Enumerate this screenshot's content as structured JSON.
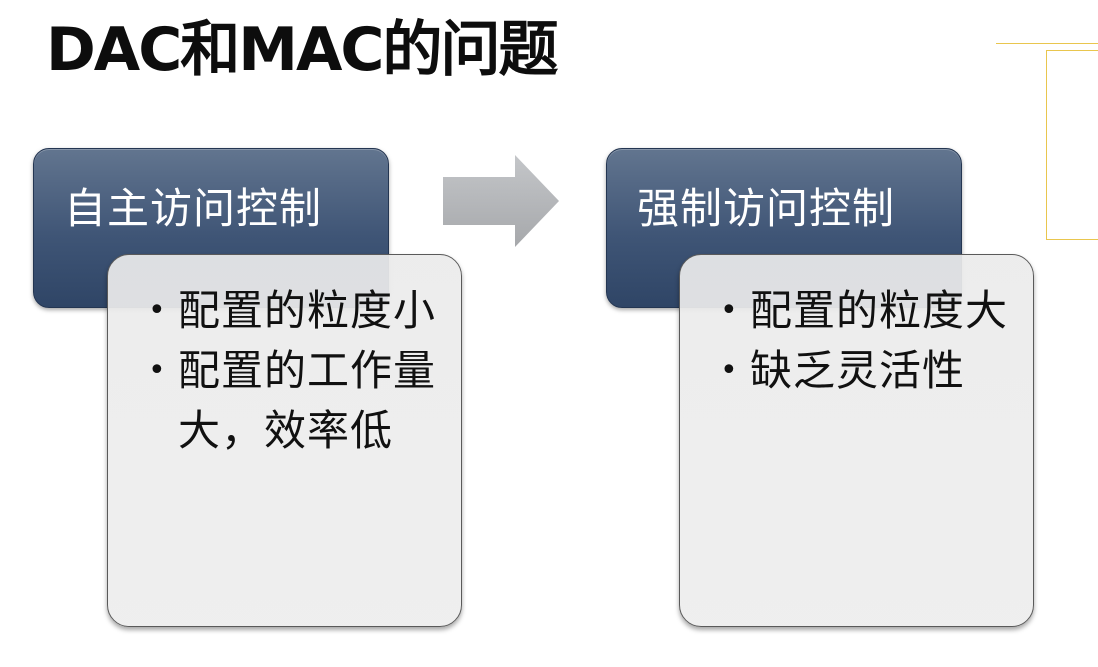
{
  "slide": {
    "title": "DAC和MAC的问题"
  },
  "colors": {
    "header_fill": "#3f5576",
    "card_fill": "#ececec",
    "arrow_fill": "#b3b5b8",
    "accent_line": "#e9c64e"
  },
  "left_panel": {
    "header": "自主访问控制",
    "bullets": [
      "配置的粒度小",
      "配置的工作量大，效率低"
    ]
  },
  "right_panel": {
    "header": "强制访问控制",
    "bullets": [
      "配置的粒度大",
      "缺乏灵活性"
    ]
  }
}
